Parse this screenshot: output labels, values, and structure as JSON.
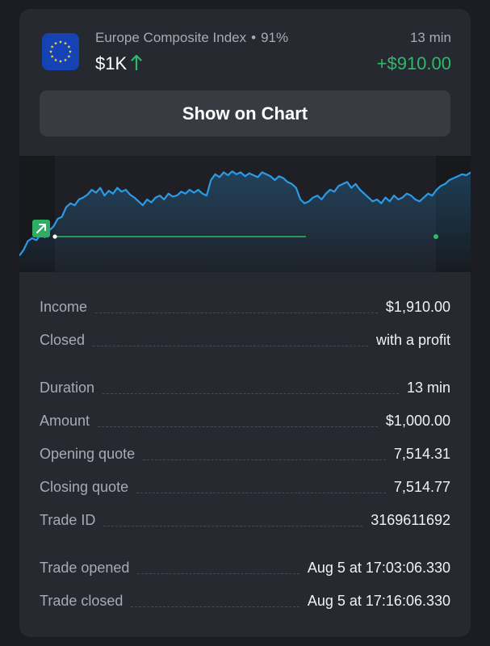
{
  "trade": {
    "asset_name": "Europe Composite Index",
    "payout": "91%",
    "amount": "$1K",
    "duration": "13 min",
    "profit": "+$910.00",
    "flag_icon": "eu-flag-icon",
    "direction_icon": "arrow-up-icon",
    "profit_color": "#2fb96a"
  },
  "actions": {
    "show_on_chart": "Show on Chart"
  },
  "chart": {
    "trade_marker_icon": "arrow-up-right-icon",
    "line_color": "#2c9ae6",
    "strike_color": "#2fb96a",
    "trend": [
      0.12,
      0.18,
      0.27,
      0.3,
      0.28,
      0.34,
      0.31,
      0.38,
      0.42,
      0.5,
      0.52,
      0.62,
      0.66,
      0.64,
      0.7,
      0.72,
      0.75,
      0.8,
      0.77,
      0.82,
      0.74,
      0.79,
      0.76,
      0.82,
      0.78,
      0.8,
      0.75,
      0.72,
      0.68,
      0.64,
      0.7,
      0.67,
      0.72,
      0.74,
      0.7,
      0.76,
      0.73,
      0.74,
      0.78,
      0.76,
      0.8,
      0.77,
      0.8,
      0.76,
      0.74,
      0.9,
      0.96,
      0.93,
      0.98,
      0.95,
      0.99,
      0.96,
      0.98,
      0.94,
      0.97,
      0.95,
      0.93,
      0.98,
      0.96,
      0.94,
      0.9,
      0.94,
      0.92,
      0.88,
      0.86,
      0.82,
      0.7,
      0.66,
      0.68,
      0.72,
      0.74,
      0.7,
      0.76,
      0.8,
      0.78,
      0.84,
      0.86,
      0.88,
      0.82,
      0.86,
      0.8,
      0.76,
      0.72,
      0.68,
      0.7,
      0.66,
      0.72,
      0.68,
      0.74,
      0.7,
      0.72,
      0.76,
      0.74,
      0.7,
      0.68,
      0.72,
      0.76,
      0.74,
      0.8,
      0.84,
      0.86,
      0.9,
      0.92,
      0.94,
      0.96,
      0.95,
      0.98
    ]
  },
  "details_group_1": [
    {
      "label": "Income",
      "value": "$1,910.00"
    },
    {
      "label": "Closed",
      "value": "with a profit"
    }
  ],
  "details_group_2": [
    {
      "label": "Duration",
      "value": "13 min"
    },
    {
      "label": "Amount",
      "value": "$1,000.00"
    },
    {
      "label": "Opening quote",
      "value": "7,514.31"
    },
    {
      "label": "Closing quote",
      "value": "7,514.77"
    },
    {
      "label": "Trade ID",
      "value": "3169611692"
    }
  ],
  "details_group_3": [
    {
      "label": "Trade opened",
      "value": "Aug 5 at 17:03:06.330"
    },
    {
      "label": "Trade closed",
      "value": "Aug 5 at 17:16:06.330"
    }
  ]
}
